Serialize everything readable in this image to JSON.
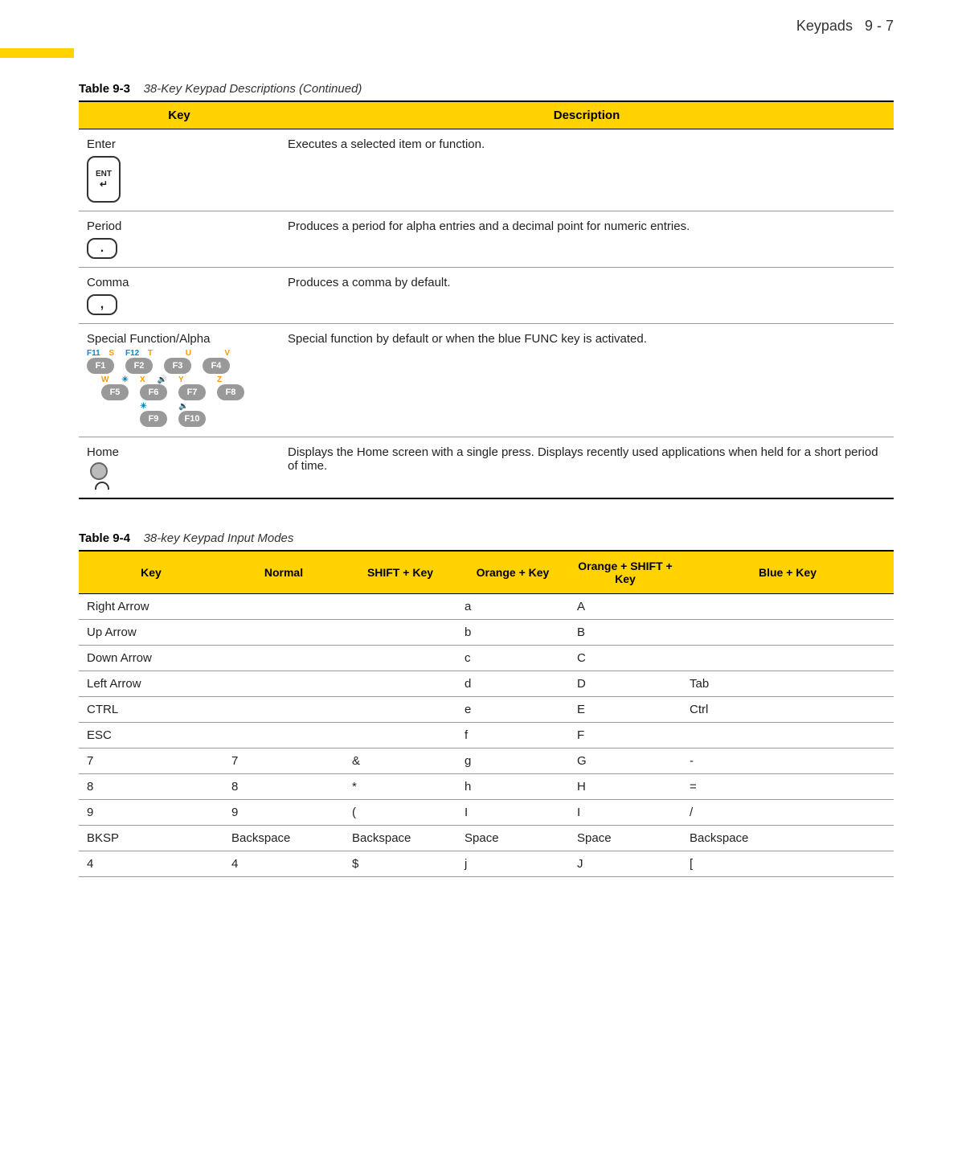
{
  "header": {
    "section_title": "Keypads",
    "page_ref": "9 - 7"
  },
  "table93": {
    "caption_label": "Table 9-3",
    "caption_title": "38-Key Keypad Descriptions  (Continued)",
    "headers": {
      "key": "Key",
      "desc": "Description"
    },
    "rows": [
      {
        "key": "Enter",
        "desc": "Executes a selected item or function."
      },
      {
        "key": "Period",
        "desc": "Produces a period for alpha entries and a decimal point for numeric entries."
      },
      {
        "key": "Comma",
        "desc": "Produces a comma by default."
      },
      {
        "key": "Special Function/Alpha",
        "desc": "Special function by default or when the blue FUNC key is activated."
      },
      {
        "key": "Home",
        "desc": "Displays the Home screen with a single press. Displays recently used applications when held for a short period of time."
      }
    ]
  },
  "table94": {
    "caption_label": "Table 9-4",
    "caption_title": "38-key Keypad Input Modes",
    "headers": {
      "key": "Key",
      "normal": "Normal",
      "shift": "SHIFT + Key",
      "orange": "Orange + Key",
      "orange_shift": "Orange + SHIFT + Key",
      "blue": "Blue + Key"
    },
    "rows": [
      {
        "key": "Right Arrow",
        "normal": "",
        "shift": "",
        "orange": "a",
        "orange_shift": "A",
        "blue": ""
      },
      {
        "key": "Up Arrow",
        "normal": "",
        "shift": "",
        "orange": "b",
        "orange_shift": "B",
        "blue": ""
      },
      {
        "key": "Down Arrow",
        "normal": "",
        "shift": "",
        "orange": "c",
        "orange_shift": "C",
        "blue": ""
      },
      {
        "key": "Left Arrow",
        "normal": "",
        "shift": "",
        "orange": "d",
        "orange_shift": "D",
        "blue": "Tab"
      },
      {
        "key": "CTRL",
        "normal": "",
        "shift": "",
        "orange": "e",
        "orange_shift": "E",
        "blue": "Ctrl"
      },
      {
        "key": "ESC",
        "normal": "",
        "shift": "",
        "orange": "f",
        "orange_shift": "F",
        "blue": ""
      },
      {
        "key": "7",
        "normal": "7",
        "shift": "&",
        "orange": "g",
        "orange_shift": "G",
        "blue": "-"
      },
      {
        "key": "8",
        "normal": "8",
        "shift": "*",
        "orange": "h",
        "orange_shift": "H",
        "blue": "="
      },
      {
        "key": "9",
        "normal": "9",
        "shift": "(",
        "orange": "I",
        "orange_shift": "I",
        "blue": "/"
      },
      {
        "key": "BKSP",
        "normal": "Backspace",
        "shift": "Backspace",
        "orange": "Space",
        "orange_shift": "Space",
        "blue": "Backspace"
      },
      {
        "key": "4",
        "normal": "4",
        "shift": "$",
        "orange": "j",
        "orange_shift": "J",
        "blue": "["
      }
    ]
  },
  "func_keys": {
    "row1_labels": [
      {
        "blue": "F11",
        "orange": "S"
      },
      {
        "blue": "F12",
        "orange": "T"
      },
      {
        "blue": "",
        "orange": "U"
      },
      {
        "blue": "",
        "orange": "V"
      }
    ],
    "row1": [
      "F1",
      "F2",
      "F3",
      "F4"
    ],
    "row2_labels": [
      {
        "blue": "",
        "orange": "W"
      },
      {
        "blue": "",
        "orange": "X"
      },
      {
        "blue": "",
        "orange": "Y"
      },
      {
        "blue": "",
        "orange": "Z"
      }
    ],
    "row2": [
      "F5",
      "F6",
      "F7",
      "F8"
    ],
    "row3": [
      "F9",
      "F10"
    ]
  },
  "ent_label": "ENT"
}
